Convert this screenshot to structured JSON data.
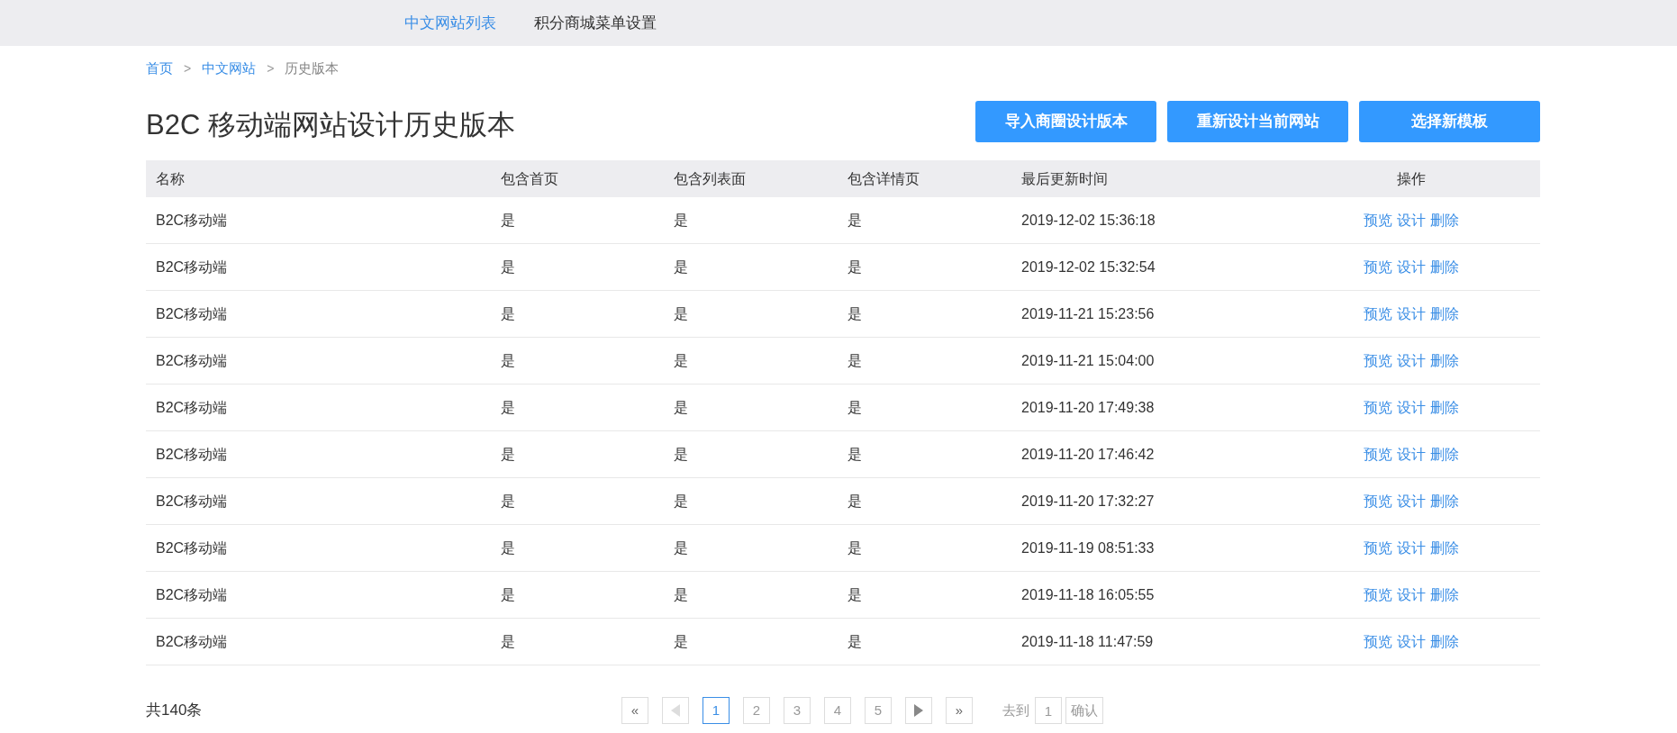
{
  "nav": [
    {
      "label": "中文网站列表",
      "selected": true
    },
    {
      "label": "积分商城菜单设置",
      "selected": false
    }
  ],
  "breadcrumb": [
    {
      "label": "首页",
      "link": true
    },
    {
      "label": "中文网站",
      "link": true
    },
    {
      "label": "历史版本",
      "link": false
    }
  ],
  "breadcrumb_separator": ">",
  "title": "B2C 移动端网站设计历史版本",
  "buttons": [
    "导入商圈设计版本",
    "重新设计当前网站",
    "选择新模板"
  ],
  "table": {
    "columns": [
      "名称",
      "包含首页",
      "包含列表面",
      "包含详情页",
      "最后更新时间",
      "操作"
    ],
    "rows": [
      {
        "cells": [
          "B2C移动端",
          "是",
          "是",
          "是",
          "2019-12-02 15:36:18"
        ],
        "actions": [
          "预览",
          "设计",
          "删除"
        ]
      },
      {
        "cells": [
          "B2C移动端",
          "是",
          "是",
          "是",
          "2019-12-02 15:32:54"
        ],
        "actions": [
          "预览",
          "设计",
          "删除"
        ]
      },
      {
        "cells": [
          "B2C移动端",
          "是",
          "是",
          "是",
          "2019-11-21 15:23:56"
        ],
        "actions": [
          "预览",
          "设计",
          "删除"
        ]
      },
      {
        "cells": [
          "B2C移动端",
          "是",
          "是",
          "是",
          "2019-11-21 15:04:00"
        ],
        "actions": [
          "预览",
          "设计",
          "删除"
        ]
      },
      {
        "cells": [
          "B2C移动端",
          "是",
          "是",
          "是",
          "2019-11-20 17:49:38"
        ],
        "actions": [
          "预览",
          "设计",
          "删除"
        ]
      },
      {
        "cells": [
          "B2C移动端",
          "是",
          "是",
          "是",
          "2019-11-20 17:46:42"
        ],
        "actions": [
          "预览",
          "设计",
          "删除"
        ]
      },
      {
        "cells": [
          "B2C移动端",
          "是",
          "是",
          "是",
          "2019-11-20 17:32:27"
        ],
        "actions": [
          "预览",
          "设计",
          "删除"
        ]
      },
      {
        "cells": [
          "B2C移动端",
          "是",
          "是",
          "是",
          "2019-11-19 08:51:33"
        ],
        "actions": [
          "预览",
          "设计",
          "删除"
        ]
      },
      {
        "cells": [
          "B2C移动端",
          "是",
          "是",
          "是",
          "2019-11-18 16:05:55"
        ],
        "actions": [
          "预览",
          "设计",
          "删除"
        ]
      },
      {
        "cells": [
          "B2C移动端",
          "是",
          "是",
          "是",
          "2019-11-18 11:47:59"
        ],
        "actions": [
          "预览",
          "设计",
          "删除"
        ]
      }
    ]
  },
  "total": "共140条",
  "pagination": {
    "first": "«",
    "prev": {
      "disabled": true
    },
    "pages": [
      {
        "label": "1",
        "selected": true
      },
      {
        "label": "2",
        "selected": false
      },
      {
        "label": "3",
        "selected": false
      },
      {
        "label": "4",
        "selected": false
      },
      {
        "label": "5",
        "selected": false
      }
    ],
    "next": {
      "disabled": false
    },
    "last": "»",
    "goto_label": "去到",
    "goto_value": "1",
    "confirm": "确认"
  }
}
